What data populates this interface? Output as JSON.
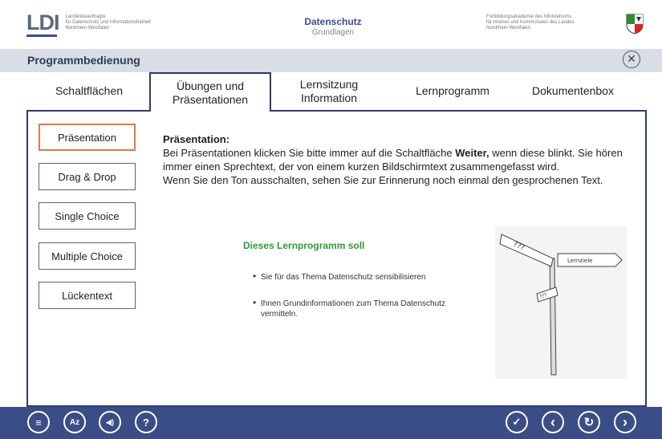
{
  "header": {
    "logo_mark": "LDI",
    "logo_text": [
      "Landesbeauftragte",
      "für Datenschutz und Informationsfreiheit",
      "Nordrhein-Westfalen"
    ],
    "course_title": "Datenschutz",
    "course_subtitle": "Grundlagen",
    "partner_text": [
      "Fortbildungsakademie des Ministeriums",
      "für Inneres und Kommunales des Landes",
      "Nordrhein-Westfalen"
    ]
  },
  "titlebar": {
    "title": "Programmbedienung",
    "close_symbol": "✕"
  },
  "tabs": [
    {
      "label": "Schaltflächen",
      "active": false
    },
    {
      "label": "Übungen und Präsentationen",
      "active": true
    },
    {
      "label": "Lernsitzung Information",
      "active": false
    },
    {
      "label": "Lernprogramm",
      "active": false
    },
    {
      "label": "Dokumentenbox",
      "active": false
    }
  ],
  "sidebar": {
    "items": [
      {
        "label": "Präsentation",
        "active": true
      },
      {
        "label": "Drag & Drop",
        "active": false
      },
      {
        "label": "Single Choice",
        "active": false
      },
      {
        "label": "Multiple Choice",
        "active": false
      },
      {
        "label": "Lückentext",
        "active": false
      }
    ]
  },
  "content": {
    "heading": "Präsentation:",
    "para1_before": "Bei Präsentationen klicken Sie bitte immer auf die Schaltfläche ",
    "para1_bold": "Weiter,",
    "para1_after": " wenn diese blinkt. Sie hören immer einen Sprechtext, der von einem kurzen Bildschirmtext zusammengefasst wird.",
    "para2": "Wenn Sie den Ton ausschalten, sehen Sie zur Erinnerung noch einmal den gesprochenen Text.",
    "goal_title": "Dieses Lernprogramm soll",
    "goals": [
      "Sie für das Thema Datenschutz sensibilisieren",
      "Ihnen Grundinformationen zum Thema Datenschutz vermitteln."
    ],
    "sign_label": "Lernziele",
    "sign_marks_1": "???",
    "sign_marks_2": "???"
  },
  "toolbar": {
    "menu_icon": "≡",
    "glossary_icon": "Az",
    "sound_icon": "◀)",
    "help_icon": "?",
    "check_icon": "✓",
    "back_icon": "‹",
    "reload_icon": "↻",
    "next_icon": "›"
  },
  "colors": {
    "toolbar_bg": "#3b4d87",
    "frame": "#2f3b6b",
    "active_side": "#e07a4a",
    "goal_green": "#2e9a3a",
    "titlebar_bg": "#d8dde6"
  }
}
